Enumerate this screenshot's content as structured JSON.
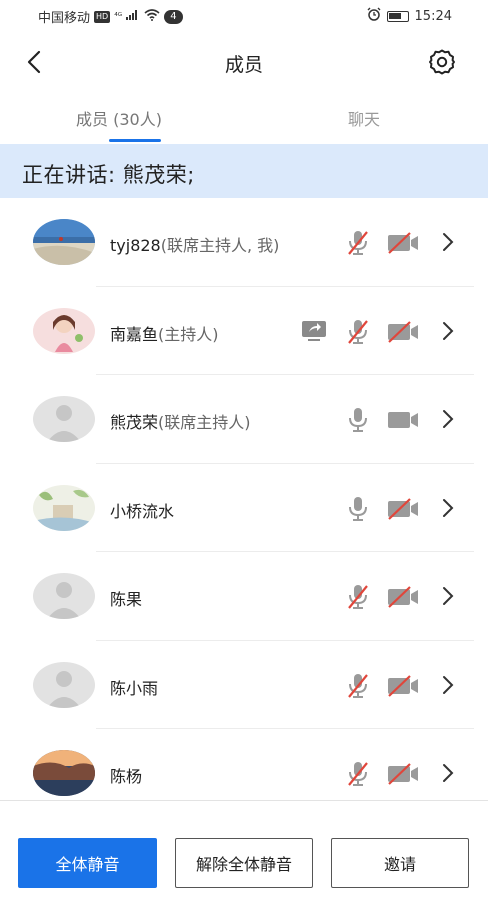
{
  "status_bar": {
    "carrier": "中国移动",
    "hd_badge": "HD",
    "network": "⁴ᴳ",
    "notification_count": "4",
    "time": "15:24"
  },
  "nav": {
    "title": "成员",
    "back_icon": "chevron-left-icon",
    "settings_icon": "gear-icon"
  },
  "tabs": [
    {
      "label": "成员 (30人)",
      "active": true
    },
    {
      "label": "聊天",
      "active": false
    }
  ],
  "speaking": {
    "text": "正在讲话: 熊茂荣;"
  },
  "members": [
    {
      "name": "tyj828",
      "role": "(联席主持人, 我)",
      "avatar": "beach-photo",
      "sharing": false,
      "mic_muted": true,
      "camera_off": true
    },
    {
      "name": "南嘉鱼",
      "role": "(主持人)",
      "avatar": "girl-illustration",
      "sharing": true,
      "mic_muted": true,
      "camera_off": true
    },
    {
      "name": "熊茂荣",
      "role": "(联席主持人)",
      "avatar": "default-person",
      "sharing": false,
      "mic_muted": false,
      "camera_off": false
    },
    {
      "name": "小桥流水",
      "role": "",
      "avatar": "painting",
      "sharing": false,
      "mic_muted": false,
      "camera_off": true
    },
    {
      "name": "陈果",
      "role": "",
      "avatar": "default-person",
      "sharing": false,
      "mic_muted": true,
      "camera_off": true
    },
    {
      "name": "陈小雨",
      "role": "",
      "avatar": "default-person",
      "sharing": false,
      "mic_muted": true,
      "camera_off": true
    },
    {
      "name": "陈杨",
      "role": "",
      "avatar": "coast-photo",
      "sharing": false,
      "mic_muted": true,
      "camera_off": true
    }
  ],
  "actions": {
    "mute_all": "全体静音",
    "unmute_all": "解除全体静音",
    "invite": "邀请"
  },
  "colors": {
    "accent": "#1a73e8",
    "banner": "#dbe9fb",
    "icon_gray": "#9a9a9a",
    "muted_red": "#e0463b"
  }
}
